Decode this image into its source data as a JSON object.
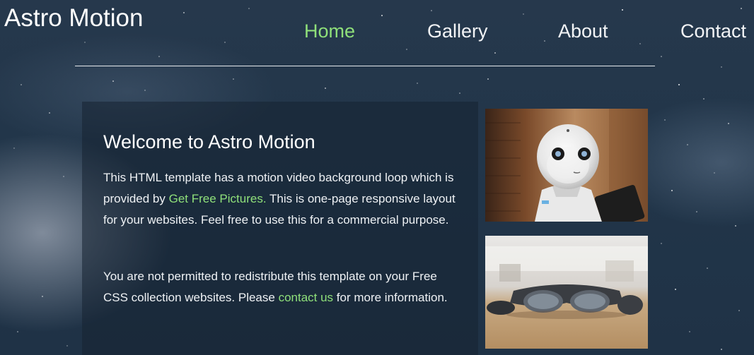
{
  "brand": {
    "title": "Astro Motion"
  },
  "nav": {
    "items": [
      {
        "label": "Home",
        "active": true
      },
      {
        "label": "Gallery",
        "active": false
      },
      {
        "label": "About",
        "active": false
      },
      {
        "label": "Contact",
        "active": false
      }
    ]
  },
  "welcome": {
    "heading": "Welcome to Astro Motion",
    "paragraph1": {
      "before": "This HTML template has a motion video background loop which is provided by ",
      "link": "Get Free Pictures.",
      "after": " This is one-page responsive layout for your websites. Feel free to use this for a commercial purpose."
    },
    "paragraph2": {
      "before": "You are not permitted to redistribute this template on your Free CSS collection websites. Please ",
      "link": "contact us",
      "after": " for more information."
    }
  },
  "gallery": {
    "images": [
      {
        "name": "robot-photo"
      },
      {
        "name": "vr-glasses-photo"
      }
    ]
  },
  "colors": {
    "accent": "#8fe07a",
    "background": "#22364a",
    "panel": "rgba(22,35,50,0.55)"
  }
}
